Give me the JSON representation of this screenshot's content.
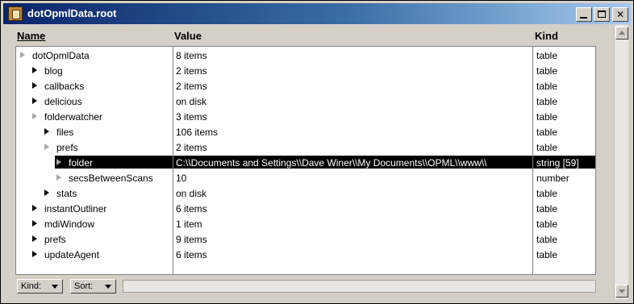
{
  "window": {
    "title": "dotOpmlData.root"
  },
  "columns": {
    "name": "Name",
    "value": "Value",
    "kind": "Kind"
  },
  "rows": [
    {
      "name": "dotOpmlData",
      "value": "8 items",
      "kind": "table",
      "level": 0,
      "expander": "gray",
      "selected": false
    },
    {
      "name": "blog",
      "value": "2 items",
      "kind": "table",
      "level": 1,
      "expander": "black",
      "selected": false
    },
    {
      "name": "callbacks",
      "value": "2 items",
      "kind": "table",
      "level": 1,
      "expander": "black",
      "selected": false
    },
    {
      "name": "delicious",
      "value": "on disk",
      "kind": "table",
      "level": 1,
      "expander": "black",
      "selected": false
    },
    {
      "name": "folderwatcher",
      "value": "3 items",
      "kind": "table",
      "level": 1,
      "expander": "gray",
      "selected": false
    },
    {
      "name": "files",
      "value": "106 items",
      "kind": "table",
      "level": 2,
      "expander": "black",
      "selected": false
    },
    {
      "name": "prefs",
      "value": "2 items",
      "kind": "table",
      "level": 2,
      "expander": "gray",
      "selected": false
    },
    {
      "name": "folder",
      "value": "C:\\\\Documents and Settings\\\\Dave Winer\\\\My Documents\\\\OPML\\\\www\\\\",
      "kind": "string [59]",
      "level": 3,
      "expander": "gray",
      "selected": true
    },
    {
      "name": "secsBetweenScans",
      "value": "10",
      "kind": "number",
      "level": 3,
      "expander": "gray",
      "selected": false
    },
    {
      "name": "stats",
      "value": "on disk",
      "kind": "table",
      "level": 2,
      "expander": "black",
      "selected": false
    },
    {
      "name": "instantOutliner",
      "value": "6 items",
      "kind": "table",
      "level": 1,
      "expander": "black",
      "selected": false
    },
    {
      "name": "mdiWindow",
      "value": "1 item",
      "kind": "table",
      "level": 1,
      "expander": "black",
      "selected": false
    },
    {
      "name": "prefs",
      "value": "9 items",
      "kind": "table",
      "level": 1,
      "expander": "black",
      "selected": false
    },
    {
      "name": "updateAgent",
      "value": "6 items",
      "kind": "table",
      "level": 1,
      "expander": "black",
      "selected": false
    }
  ],
  "footer": {
    "kind_label": "Kind:",
    "sort_label": "Sort:"
  }
}
